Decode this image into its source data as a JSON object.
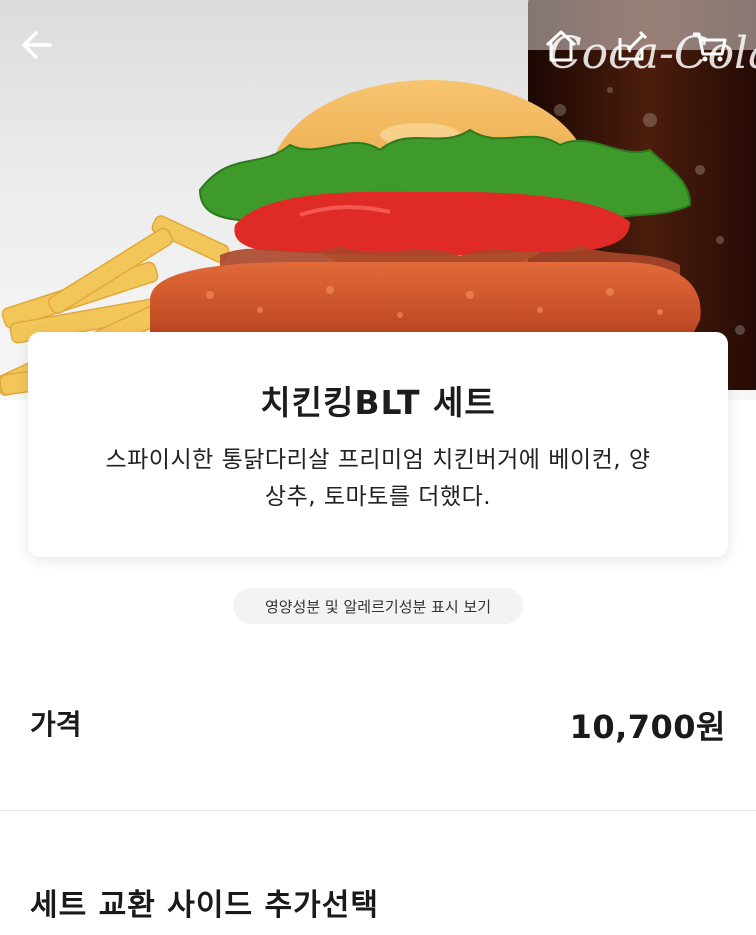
{
  "header": {
    "back_icon": "arrow-left-icon",
    "home_icon": "home-icon",
    "edit_icon": "edit-icon",
    "cart_icon": "cart-icon",
    "brand_logo_text": "Coca-Cola"
  },
  "product": {
    "title": "치킨킹BLT 세트",
    "description": "스파이시한 통닭다리살 프리미엄 치킨버거에 베이컨, 양상추, 토마토를 더했다.",
    "nutrition_button": "영양성분 및 알레르기성분 표시 보기"
  },
  "price": {
    "label": "가격",
    "value": "10,700원"
  },
  "options": {
    "section_title": "세트 교환 사이드 추가선택"
  },
  "colors": {
    "bun": "#f0a84a",
    "lettuce": "#3f9a2c",
    "tomato": "#e02a25",
    "patty": "#d85a30",
    "fries": "#f3c65a",
    "cola": "#3a1608"
  }
}
